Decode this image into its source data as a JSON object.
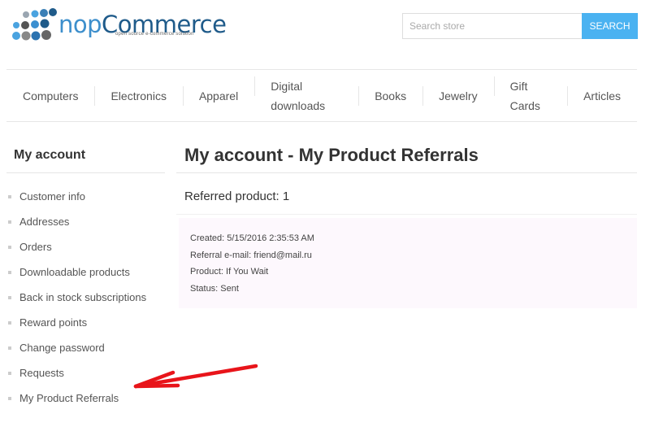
{
  "header": {
    "logo": {
      "brand_prefix": "nop",
      "brand_suffix": "Commerce",
      "tagline": "open source e-commerce solution",
      "icon": "dots-logo-icon"
    },
    "search": {
      "placeholder": "Search store",
      "value": "",
      "button_label": "SEARCH",
      "button_color": "#4ab2f1"
    }
  },
  "menu": {
    "items": [
      {
        "label": "Computers"
      },
      {
        "label": "Electronics"
      },
      {
        "label": "Apparel"
      },
      {
        "label": "Digital downloads"
      },
      {
        "label": "Books"
      },
      {
        "label": "Jewelry"
      },
      {
        "label": "Gift Cards"
      },
      {
        "label": "Articles"
      }
    ]
  },
  "sidebar": {
    "title": "My account",
    "items": [
      {
        "label": "Customer info"
      },
      {
        "label": "Addresses"
      },
      {
        "label": "Orders"
      },
      {
        "label": "Downloadable products"
      },
      {
        "label": "Back in stock subscriptions"
      },
      {
        "label": "Reward points"
      },
      {
        "label": "Change password"
      },
      {
        "label": "Requests"
      },
      {
        "label": "My Product Referrals"
      }
    ]
  },
  "main": {
    "page_title": "My account - My Product Referrals",
    "referred_count_label": "Referred product: 1",
    "referral": {
      "created": "Created: 5/15/2016 2:35:53 AM",
      "email": "Referral e-mail: friend@mail.ru",
      "product": "Product: If You Wait",
      "status": "Status: Sent"
    }
  },
  "annotation": {
    "arrow_icon": "red-arrow-icon",
    "arrow_color": "#e8141a"
  }
}
